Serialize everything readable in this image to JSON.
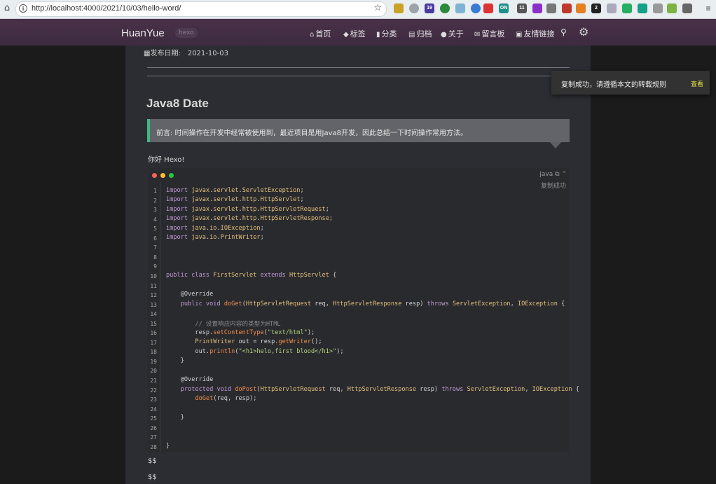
{
  "browser": {
    "url": "http://localhost:4000/2021/10/03/hello-word/",
    "extension_badges": [
      "19",
      "ON",
      "11",
      "2"
    ]
  },
  "site": {
    "brand": "HuanYue",
    "brand_tag": "hexo",
    "nav": [
      {
        "icon": "home-icon",
        "glyph": "⌂",
        "label": "首页"
      },
      {
        "icon": "tags-icon",
        "glyph": "◆",
        "label": "标签"
      },
      {
        "icon": "category-icon",
        "glyph": "▮",
        "label": "分类"
      },
      {
        "icon": "archive-icon",
        "glyph": "▤",
        "label": "归档"
      },
      {
        "icon": "user-icon",
        "glyph": "●",
        "label": "关于"
      },
      {
        "icon": "comments-icon",
        "glyph": "✉",
        "label": "留言板"
      },
      {
        "icon": "link-icon",
        "glyph": "▣",
        "label": "友情链接"
      }
    ]
  },
  "post": {
    "meta_label": "发布日期:",
    "date": "2021-10-03",
    "title": "Java8 Date",
    "preface": "前言: 时间操作在开发中经常被使用到，最近项目是用Java8开发，因此总结一下时间操作常用方法。",
    "hello": "你好 Hexo!",
    "code": {
      "language": "java",
      "copied_label": "复制成功",
      "line_numbers": [
        "1",
        "2",
        "3",
        "4",
        "5",
        "6",
        "7",
        "8",
        "9",
        "10",
        "11",
        "12",
        "13",
        "14",
        "15",
        "16",
        "17",
        "18",
        "19",
        "20",
        "21",
        "22",
        "23",
        "24",
        "25",
        "26",
        "27",
        "28"
      ]
    },
    "math_1": "$$",
    "math_2": "$$"
  },
  "toast": {
    "message": "复制成功，请遵循本文的转载规则",
    "action": "查看"
  }
}
